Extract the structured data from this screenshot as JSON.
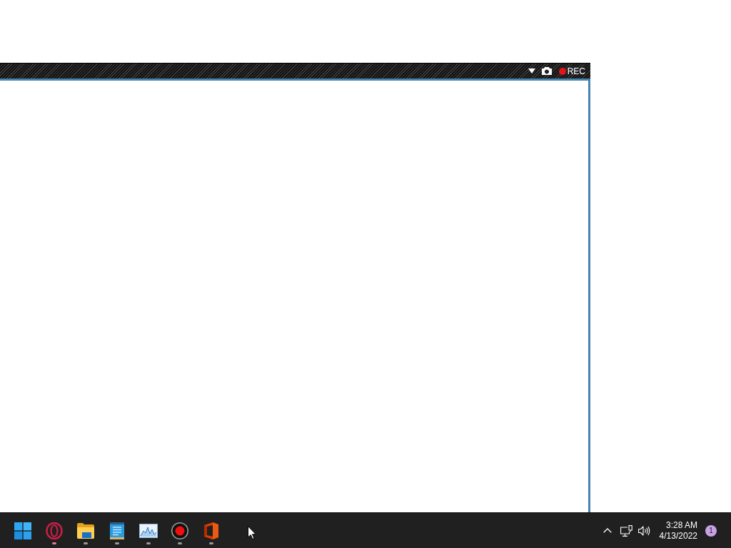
{
  "capture_toolbar": {
    "record_label": "REC"
  },
  "taskbar": {
    "apps": [
      {
        "kind": "ring",
        "active": true
      },
      {
        "kind": "folder",
        "active": false
      },
      {
        "kind": "notepad",
        "active": false
      },
      {
        "kind": "chart",
        "active": false
      },
      {
        "kind": "record",
        "active": false
      },
      {
        "kind": "logo",
        "active": false
      }
    ],
    "clock": {
      "time": "3:28 AM",
      "date": "4/13/2022"
    },
    "notification_count": "1"
  }
}
